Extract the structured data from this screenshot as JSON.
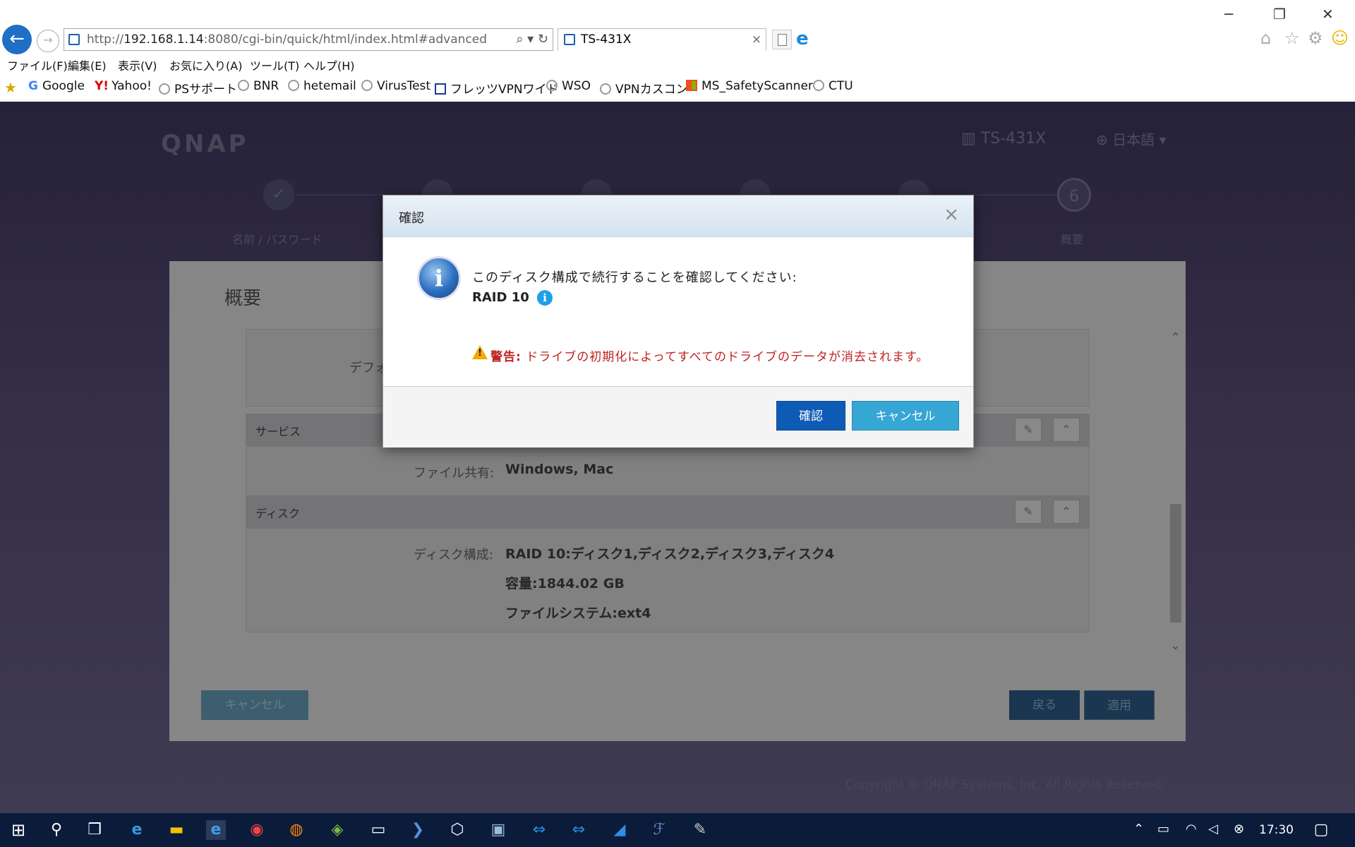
{
  "browser": {
    "address_url_prefix": "http://",
    "address_host": "192.168.1.14",
    "address_url_rest": ":8080/cgi-bin/quick/html/index.html#advanced",
    "tab_title": "TS-431X",
    "tab_close": "×",
    "menu": [
      "ファイル(F)",
      "編集(E)",
      "表示(V)",
      "お気に入り(A)",
      "ツール(T)",
      "ヘルプ(H)"
    ],
    "favorites": [
      "Google",
      "Yahoo!",
      "PSサポート",
      "BNR",
      "hetemail",
      "VirusTest",
      "フレッツVPNワイド",
      "WSO",
      "VPNカスコン",
      "MS_SafetyScanner",
      "CTU"
    ]
  },
  "page": {
    "logo": "QNAP",
    "model": "TS-431X",
    "language": "日本語",
    "steps": [
      {
        "label": "名前 / パスワード",
        "mark": "✓"
      },
      {
        "label": "",
        "mark": ""
      },
      {
        "label": "",
        "mark": ""
      },
      {
        "label": "",
        "mark": ""
      },
      {
        "label": "",
        "mark": ""
      },
      {
        "label": "概要",
        "mark": "6"
      }
    ],
    "summary_title": "概要",
    "partial_default": "デフォ",
    "services_header": "サービス",
    "file_share_label": "ファイル共有:",
    "file_share_value": "Windows, Mac",
    "disk_header": "ディスク",
    "disk_config_label": "ディスク構成:",
    "disk_config_value": "RAID 10:ディスク1,ディスク2,ディスク3,ディスク4",
    "capacity_value": "容量:1844.02 GB",
    "filesystem_value": "ファイルシステム:ext4",
    "cancel_button": "キャンセル",
    "back_button": "戻る",
    "apply_button": "適用",
    "copyright": "Copyright © QNAP Systems, Inc. All Rights Reserved."
  },
  "dialog": {
    "title": "確認",
    "close": "×",
    "message": "このディスク構成で続行することを確認してください:",
    "raid": "RAID 10",
    "warning_prefix": "警告:",
    "warning_text": "ドライブの初期化によってすべてのドライブのデータが消去されます。",
    "confirm_button": "確認",
    "cancel_button": "キャンセル"
  },
  "taskbar": {
    "clock": "17:30"
  },
  "colors": {
    "dialog_confirm": "#0e5bb5",
    "dialog_cancel": "#36a6d4",
    "warning": "#c02222",
    "taskbar": "#0b1b3a"
  }
}
